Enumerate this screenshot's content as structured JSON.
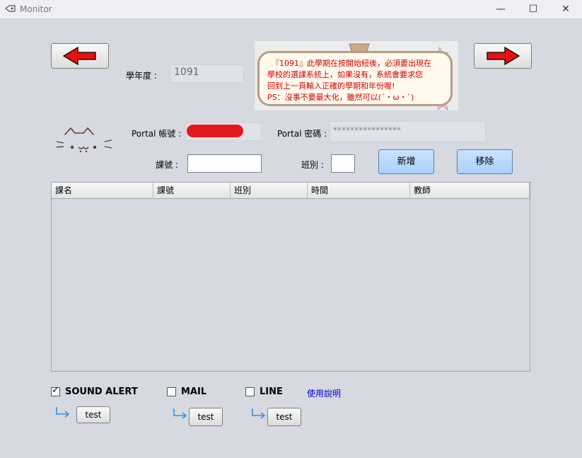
{
  "window": {
    "title": "Monitor",
    "controls": [
      "—",
      "☐",
      "✕"
    ]
  },
  "form": {
    "year_label": "學年度 :",
    "year_value": "1091",
    "portal_account_label": "Portal 帳號 :",
    "portal_password_label": "Portal 密碼 :",
    "portal_password_value": "****************",
    "course_no_label": "課號 :",
    "class_label": "班別 :",
    "add_button": "新增",
    "remove_button": "移除"
  },
  "notice": {
    "lines": [
      "『1091』此學期在按開始紐後，必須要出現在",
      "學校的選課系統上，如果沒有，系統會要求您",
      "回到上一頁輸入正確的學期和年份喔!",
      "PS：沒事不要最大化，雖然可以(´・ω・`)"
    ]
  },
  "table": {
    "columns": [
      "課名",
      "課號",
      "班別",
      "時間",
      "教師"
    ]
  },
  "alerts": {
    "sound": {
      "label": "SOUND ALERT",
      "checked": true,
      "test": "test"
    },
    "mail": {
      "label": "MAIL",
      "checked": false,
      "test": "test"
    },
    "line": {
      "label": "LINE",
      "checked": false,
      "test": "test"
    },
    "help_link": "使用說明"
  },
  "icons": {
    "prev": "red-left-arrow-icon",
    "next": "red-right-arrow-icon",
    "cat": "cat-face-icon",
    "return": "return-arrow-icon"
  },
  "colors": {
    "accent_arrow": "#e81010",
    "notice_text": "#d40000",
    "link": "#0000cc",
    "button_blue": "#b7d9fd"
  }
}
